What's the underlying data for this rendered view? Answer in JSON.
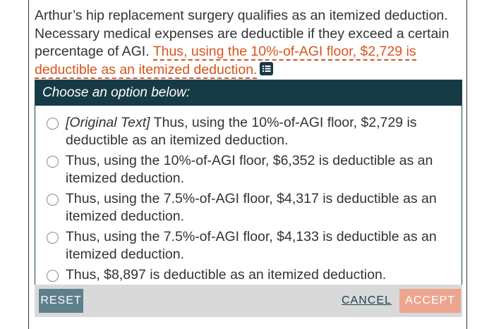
{
  "passage": {
    "plain_text": "Arthur’s hip replacement surgery qualifies as an itemized deduction. Necessary medical expenses are deductible if they exceed a certain percentage of AGI.",
    "highlighted_text": "Thus, using the 10%-of-AGI floor, $2,729 is deductible as an itemized deduction.",
    "icon": "list-icon"
  },
  "panel": {
    "header": "Choose an option below:",
    "options": [
      {
        "tag": "[Original Text]",
        "text": " Thus, using the 10%-of-AGI floor, $2,729 is deductible as an itemized deduction."
      },
      {
        "tag": "",
        "text": "Thus, using the 10%-of-AGI floor, $6,352 is deductible as an itemized deduction."
      },
      {
        "tag": "",
        "text": "Thus, using the 7.5%-of-AGI floor, $4,317 is deductible as an itemized deduction."
      },
      {
        "tag": "",
        "text": "Thus, using the 7.5%-of-AGI floor, $4,133 is deductible as an itemized deduction."
      },
      {
        "tag": "",
        "text": "Thus, $8,897 is deductible as an itemized deduction."
      }
    ]
  },
  "footer": {
    "reset_label": "RESET",
    "cancel_label": "CANCEL",
    "accept_label": "ACCEPT"
  },
  "colors": {
    "header_bg": "#173a47",
    "highlight": "#d9541e",
    "reset_bg": "#607f8c",
    "accept_bg": "#eda58f",
    "footer_bg": "#d9d9d9"
  }
}
